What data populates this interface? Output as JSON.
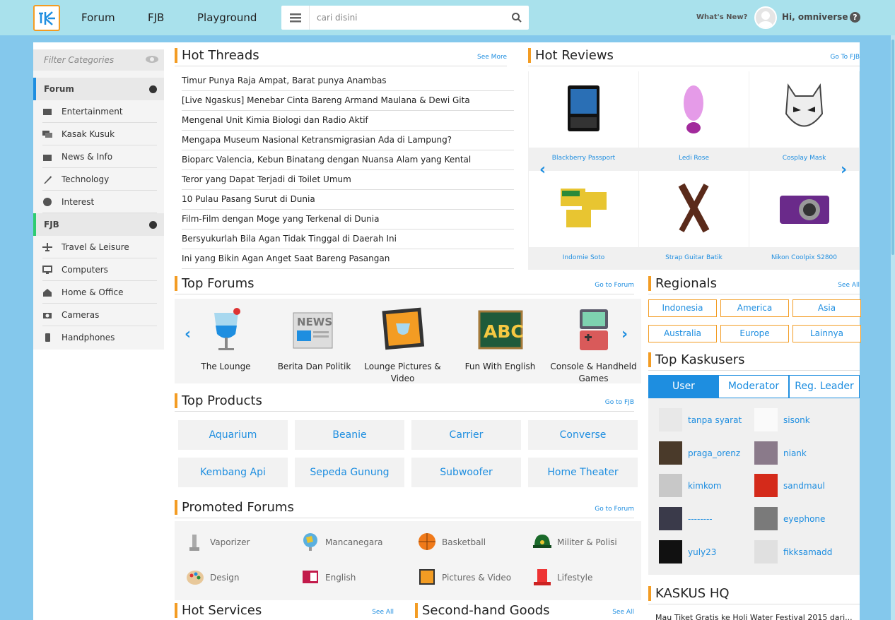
{
  "header": {
    "nav": [
      "Forum",
      "FJB",
      "Playground"
    ],
    "search_placeholder": "cari disini",
    "whats_new": "What's New?",
    "greeting": "Hi, omniverse",
    "help": "?"
  },
  "sidebar": {
    "filter_placeholder": "Filter Categories",
    "groups": [
      {
        "title": "Forum",
        "items": [
          "Entertainment",
          "Kasak Kusuk",
          "News & Info",
          "Technology",
          "Interest"
        ]
      },
      {
        "title": "FJB",
        "items": [
          "Travel & Leisure",
          "Computers",
          "Home & Office",
          "Cameras",
          "Handphones"
        ]
      }
    ]
  },
  "hot_threads": {
    "title": "Hot Threads",
    "more": "See More",
    "items": [
      "Timur Punya Raja Ampat, Barat punya Anambas",
      "[Live Ngaskus] Menebar Cinta Bareng Armand Maulana & Dewi Gita",
      "Mengenal Unit Kimia Biologi dan Radio Aktif",
      "Mengapa Museum Nasional Ketransmigrasian Ada di Lampung?",
      "Bioparc Valencia, Kebun Binatang dengan Nuansa Alam yang Kental",
      "Teror yang Dapat Terjadi di Toilet Umum",
      "10 Pulau Pasang Surut di Dunia",
      "Film-Film dengan Moge yang Terkenal di Dunia",
      "Bersyukurlah Bila Agan Tidak Tinggal di Daerah Ini",
      "Ini yang Bikin Agan Anget Saat Bareng Pasangan"
    ]
  },
  "hot_reviews": {
    "title": "Hot Reviews",
    "more": "Go To FJB",
    "items": [
      "Blackberry Passport",
      "Ledi Rose",
      "Cosplay Mask",
      "Indomie Soto",
      "Strap Guitar Batik",
      "Nikon Coolpix S2800"
    ]
  },
  "top_forums": {
    "title": "Top Forums",
    "more": "Go to Forum",
    "items": [
      "The Lounge",
      "Berita Dan Politik",
      "Lounge Pictures & Video",
      "Fun With English",
      "Console & Handheld Games"
    ]
  },
  "top_products": {
    "title": "Top Products",
    "more": "Go to FJB",
    "items": [
      "Aquarium",
      "Beanie",
      "Carrier",
      "Converse",
      "Kembang Api",
      "Sepeda Gunung",
      "Subwoofer",
      "Home Theater"
    ]
  },
  "promoted_forums": {
    "title": "Promoted Forums",
    "more": "Go to Forum",
    "items": [
      "Vaporizer",
      "Mancanegara",
      "Basketball",
      "Militer & Polisi",
      "Design",
      "English",
      "Pictures & Video",
      "Lifestyle"
    ]
  },
  "hot_services": {
    "title": "Hot Services",
    "more": "See All"
  },
  "second_hand": {
    "title": "Second-hand Goods",
    "more": "See All"
  },
  "regionals": {
    "title": "Regionals",
    "more": "See All",
    "items": [
      "Indonesia",
      "America",
      "Asia",
      "Australia",
      "Europe",
      "Lainnya"
    ]
  },
  "top_kaskusers": {
    "title": "Top Kaskusers",
    "tabs": [
      "User",
      "Moderator",
      "Reg. Leader"
    ],
    "users": [
      "tanpa syarat",
      "sisonk",
      "praga_orenz",
      "niank",
      "kimkom",
      "sandmaul",
      "--------",
      "eyephone",
      "yuly23",
      "fikksamadd"
    ]
  },
  "kaskus_hq": {
    "title": "KASKUS HQ",
    "item": "Mau Tiket Gratis ke Holi Water Festival 2015 dari..."
  }
}
